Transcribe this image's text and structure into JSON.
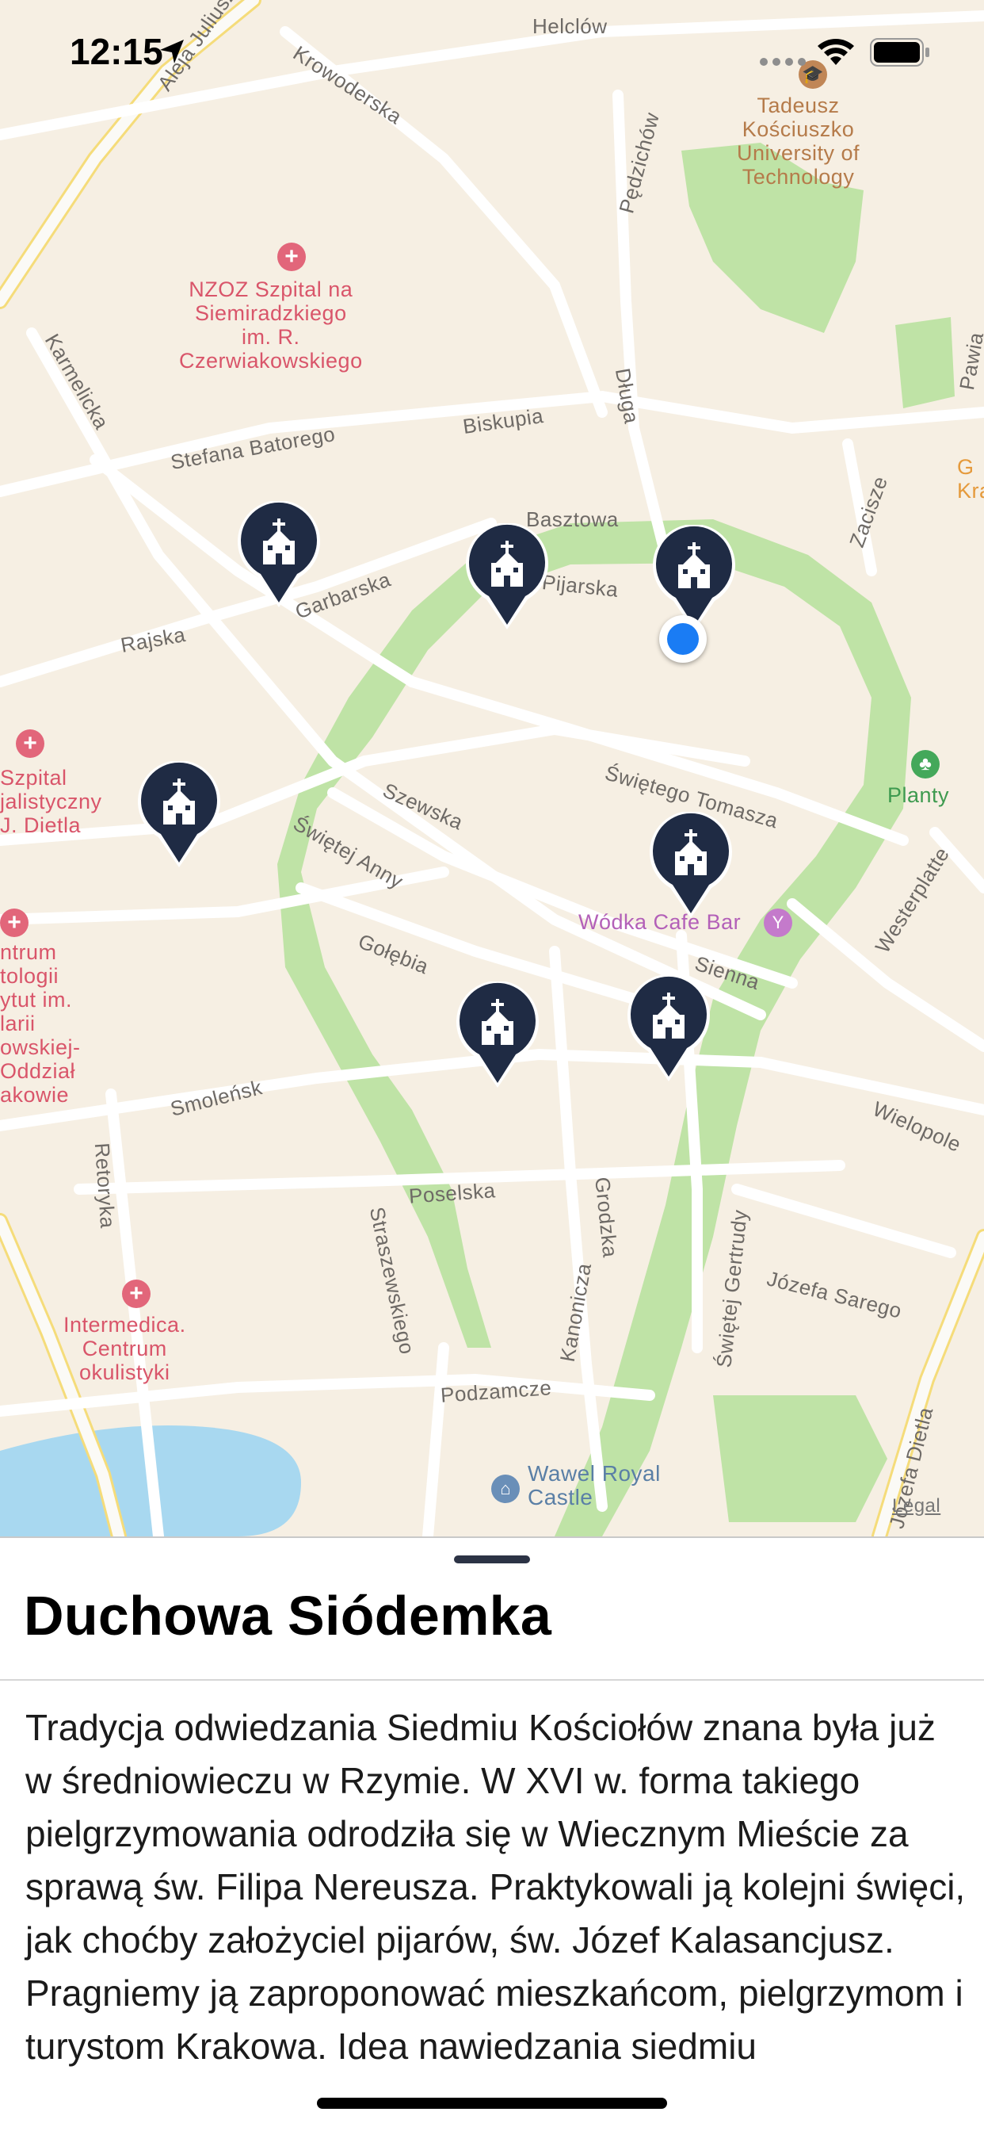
{
  "status_bar": {
    "time": "12:15"
  },
  "map": {
    "streets": [
      "Helclów",
      "Krowoderska",
      "Pędzichów",
      "Karmelicka",
      "Stefana Batorego",
      "Biskupia",
      "Długa",
      "Basztowa",
      "Pijarska",
      "Zacisze",
      "Pawia",
      "Garbarska",
      "Rajska",
      "Szewska",
      "Świętego Tomasza",
      "Świętej Anny",
      "Gołębia",
      "Sienna",
      "Westerplatte",
      "Smoleńsk",
      "Retoryka",
      "Poselska",
      "Straszewskiego",
      "Grodzka",
      "Kanonicza",
      "Świętej Gertrudy",
      "Józefa Sarego",
      "Wielopole",
      "Podzamcze",
      "Józefa Dietla",
      "Aleja Juliusza"
    ],
    "pois": {
      "hospital_1": "NZOZ Szpital na\nSiemiradzkiego\nim. R.\nCzerwiakowskiego",
      "university": "Tadeusz\nKościuszko\nUniversity of\nTechnology",
      "hospital_2": "Szpital\njalistyczny\nJ. Dietla",
      "hospital_3": "ntrum\ntologii\nytut im.\nlarii\nowskiej-\nOddział\nakowie",
      "clinic": "Intermedica.\nCentrum\nokulistyki",
      "park": "Planty",
      "bar": "Wódka Cafe Bar",
      "castle": "Wawel Royal\nCastle",
      "edge_g": "G\nKra"
    },
    "legal_label": "Legal",
    "pin_icon": "church-icon",
    "pin_count": 7
  },
  "sheet": {
    "title": "Duchowa Siódemka",
    "body": "Tradycja odwiedzania Siedmiu Kościołów znana była już w średniowieczu w Rzymie. W XVI w. forma takiego pielgrzymowania odrodziła się w Wiecznym Mieście za sprawą św. Filipa Nereusza. Praktykowali ją kolejni święci, jak choćby założyciel pijarów, św. Józef Kalasancjusz. Pragniemy ją zaproponować mieszkańcom, pielgrzymom i turystom Krakowa. Idea nawiedzania siedmiu"
  },
  "colors": {
    "map_bg": "#f6efe3",
    "park": "#bfe3a6",
    "river": "#a8d8f0",
    "pin": "#1f2b44",
    "user_location": "#1a7cf4"
  }
}
